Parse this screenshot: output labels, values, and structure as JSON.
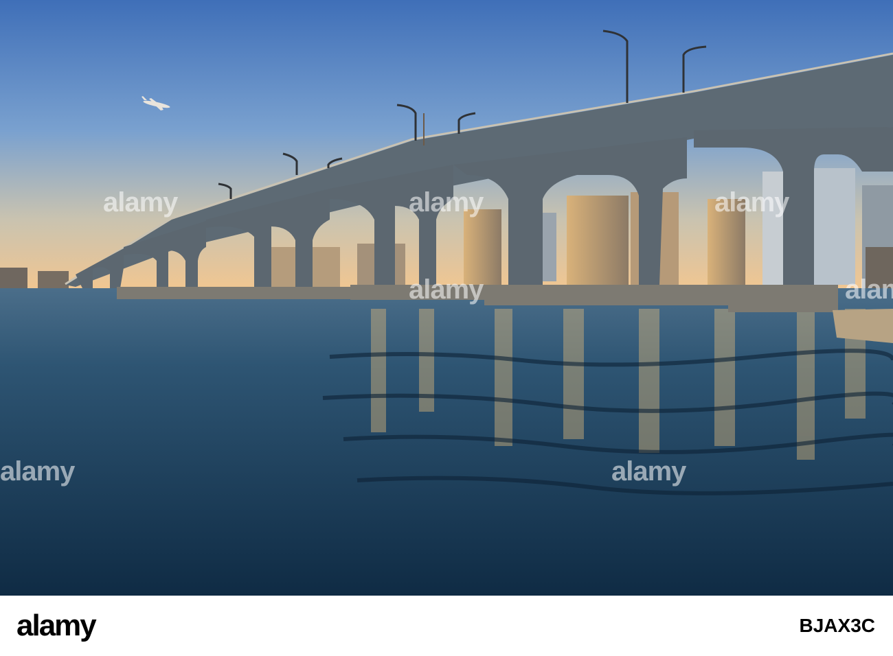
{
  "watermark": {
    "text": "alamy"
  },
  "footer": {
    "brand": "alamy",
    "image_id": "BJAX3C"
  },
  "colors": {
    "sky_top": "#3f6fb8",
    "sky_horizon": "#f2c690",
    "water": "#1e3f5c",
    "bridge": "#5d6a74",
    "footer_bg": "#ffffff",
    "brand_text": "#000000"
  }
}
